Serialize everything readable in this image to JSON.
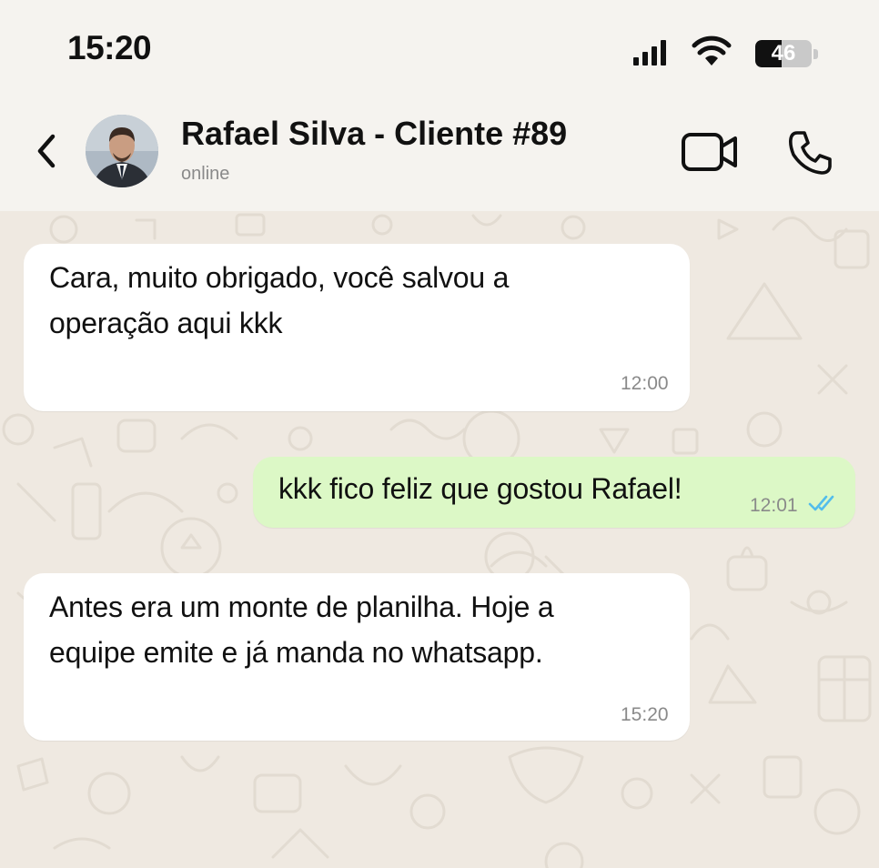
{
  "status_bar": {
    "time": "15:20",
    "battery_level": "46",
    "battery_percent": 46,
    "icons": [
      "signal-icon",
      "wifi-icon",
      "battery-icon"
    ]
  },
  "header": {
    "contact_name": "Rafael Silva - Cliente #89",
    "contact_status": "online",
    "icons": [
      "back-arrow-icon",
      "avatar",
      "video-camera-icon",
      "phone-icon"
    ]
  },
  "colors": {
    "incoming_bubble": "#ffffff",
    "outgoing_bubble": "#dcf8c6",
    "read_ticks": "#53bdeb",
    "chat_background": "#efe9e1"
  },
  "messages": [
    {
      "direction": "incoming",
      "lines": [
        "Cara, muito obrigado, você salvou a",
        "operação aqui kkk"
      ],
      "time": "12:00"
    },
    {
      "direction": "outgoing",
      "lines": [
        "kkk fico feliz que gostou Rafael!"
      ],
      "time": "12:01",
      "status": "read"
    },
    {
      "direction": "incoming",
      "lines": [
        "Antes era um monte de planilha. Hoje a",
        "equipe emite e já manda no whatsapp."
      ],
      "time": "15:20"
    }
  ]
}
